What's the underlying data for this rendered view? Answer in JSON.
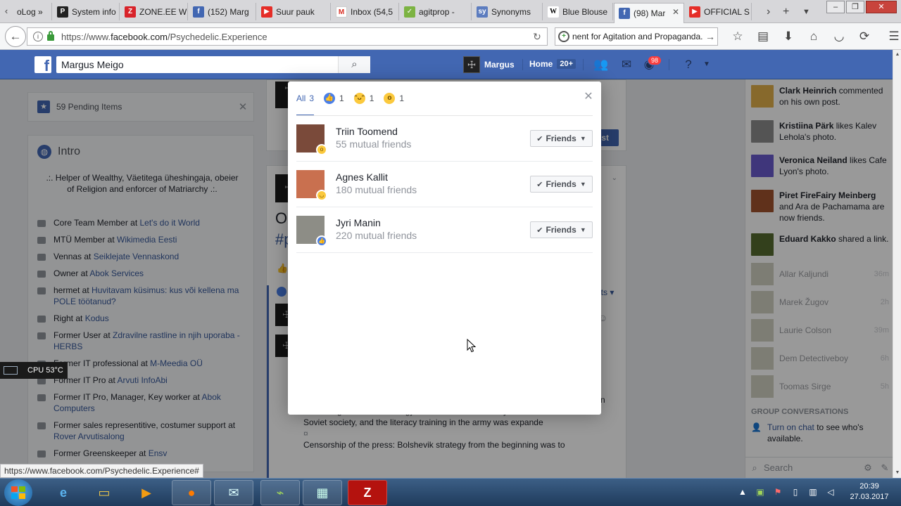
{
  "browser": {
    "tabs": [
      {
        "label": "oLog »",
        "favicon": "blog-icon",
        "color": "#6b6b6b"
      },
      {
        "label": "System info",
        "favicon": "ps-icon",
        "color": "#222222"
      },
      {
        "label": "ZONE.EE W",
        "favicon": "zone-icon",
        "color": "#d8232a"
      },
      {
        "label": "(152) Marg",
        "favicon": "facebook-icon",
        "color": "#4267b2"
      },
      {
        "label": "Suur pauk",
        "favicon": "youtube-icon",
        "color": "#e52d27"
      },
      {
        "label": "Inbox (54,5",
        "favicon": "gmail-icon",
        "color": "#d93025"
      },
      {
        "label": "agitprop -",
        "favicon": "check-icon",
        "color": "#7cb342"
      },
      {
        "label": "Synonyms",
        "favicon": "synonyms-icon",
        "color": "#5c7cbf"
      },
      {
        "label": "Blue Blouse",
        "favicon": "wikipedia-icon",
        "color": "#ffffff"
      },
      {
        "label": "(98) Mar",
        "favicon": "facebook-icon",
        "color": "#4267b2",
        "active": true
      },
      {
        "label": "OFFICIAL S",
        "favicon": "youtube-icon",
        "color": "#e52d27"
      }
    ],
    "url_prefix": "https://www.",
    "url_domain": "facebook.com",
    "url_path": "/Psychedelic.Experience",
    "search_value": "nent for Agitation and Propaganda.\"",
    "status_url": "https://www.facebook.com/Psychedelic.Experience#"
  },
  "fb": {
    "search_value": "Margus Meigo",
    "profile_name": "Margus",
    "home_label": "Home",
    "home_count": "20+",
    "notif_count": "98"
  },
  "left": {
    "pending_label": "59 Pending Items",
    "intro_title": "Intro",
    "intro_bio": ".:. Helper of Wealthy, Väetitega üheshingaja, obeier of Religion and enforcer of Matriarchy .:.",
    "items": [
      {
        "pre": "Core Team Member at ",
        "link": "Let's do it World"
      },
      {
        "pre": "MTÜ Member at ",
        "link": "Wikimedia Eesti"
      },
      {
        "pre": "Vennas at ",
        "link": "Seiklejate Vennaskond"
      },
      {
        "pre": "Owner at ",
        "link": "Abok Services"
      },
      {
        "pre": "hermet at ",
        "link": "Huvitavam küsimus: kus või kellena ma POLE töötanud?"
      },
      {
        "pre": "Right at ",
        "link": "Kodus"
      },
      {
        "pre": "Former User at ",
        "link": "Zdravilne rastline in njih uporaba - HERBS"
      },
      {
        "pre": "Former IT professional at ",
        "link": "M-Meedia OÜ"
      },
      {
        "pre": "Former IT Pro at ",
        "link": "Arvuti InfoAbi"
      },
      {
        "pre": "Former IT Pro, Manager, Key worker at ",
        "link": "Abok Computers"
      },
      {
        "pre": "Former sales representitive, costumer support at ",
        "link": "Rover Arvutisalong"
      },
      {
        "pre": "Former Greenskeeper at ",
        "link": "Ensv"
      }
    ]
  },
  "center": {
    "frag_o": "O",
    "frag_p": "#p",
    "frag_btn": "st",
    "frag_nts": "nts",
    "frag_n": "n",
    "post_text": "operation into a network of illiteracy centers. New textbooks were created, containing Bolshevik ideology to indoctrinate the newly literate members of Soviet society, and the literacy training in the army was expande",
    "post_symbol": "¤",
    "post_text2": "Censorship of the press: Bolshevik strategy from the beginning was to"
  },
  "right": {
    "ticker": [
      {
        "who": "Clark Heinrich",
        "rest": " commented on his own post.",
        "color": "#e2b04a"
      },
      {
        "who": "Kristiina Pärk",
        "rest": " likes Kalev Lehola's photo.",
        "color": "#8c8c8c"
      },
      {
        "who": "Veronica Neiland",
        "rest": " likes Cafe Lyon's photo.",
        "color": "#6a5acd"
      },
      {
        "who": "Piret FireFairy Meinberg",
        "rest": " and Ara de Pachamama are now friends.",
        "color": "#a0522d"
      },
      {
        "who": "Eduard Kakko",
        "rest": " shared a link.",
        "color": "#556b2f"
      }
    ],
    "chats": [
      {
        "name": "Allar Kaljundi",
        "time": "36m"
      },
      {
        "name": "Marek Žugov",
        "time": "2h"
      },
      {
        "name": "Laurie Colson",
        "time": "39m"
      },
      {
        "name": "Dem Detectiveboy",
        "time": "6h"
      },
      {
        "name": "Toomas Sirge",
        "time": "5h"
      }
    ],
    "group_head": "GROUP CONVERSATIONS",
    "turn_on_link": "Turn on chat",
    "turn_on_rest": " to see who's available.",
    "search_placeholder": "Search"
  },
  "modal": {
    "tab_all": "All",
    "tab_all_count": "3",
    "tab_like_count": "1",
    "tab_haha_count": "1",
    "tab_wow_count": "1",
    "people": [
      {
        "name": "Triin Toomend",
        "mutual": "55 mutual friends",
        "reaction": "wow",
        "button": "Friends",
        "avatar_color": "#7a4a3a"
      },
      {
        "name": "Agnes Kallit",
        "mutual": "180 mutual friends",
        "reaction": "haha",
        "button": "Friends",
        "avatar_color": "#c9704f"
      },
      {
        "name": "Jyri Manin",
        "mutual": "220 mutual friends",
        "reaction": "like",
        "button": "Friends",
        "avatar_color": "#8d8d86"
      }
    ]
  },
  "widgets": {
    "cpu": "CPU 53°C"
  },
  "taskbar": {
    "time": "20:39",
    "date": "27.03.2017"
  }
}
